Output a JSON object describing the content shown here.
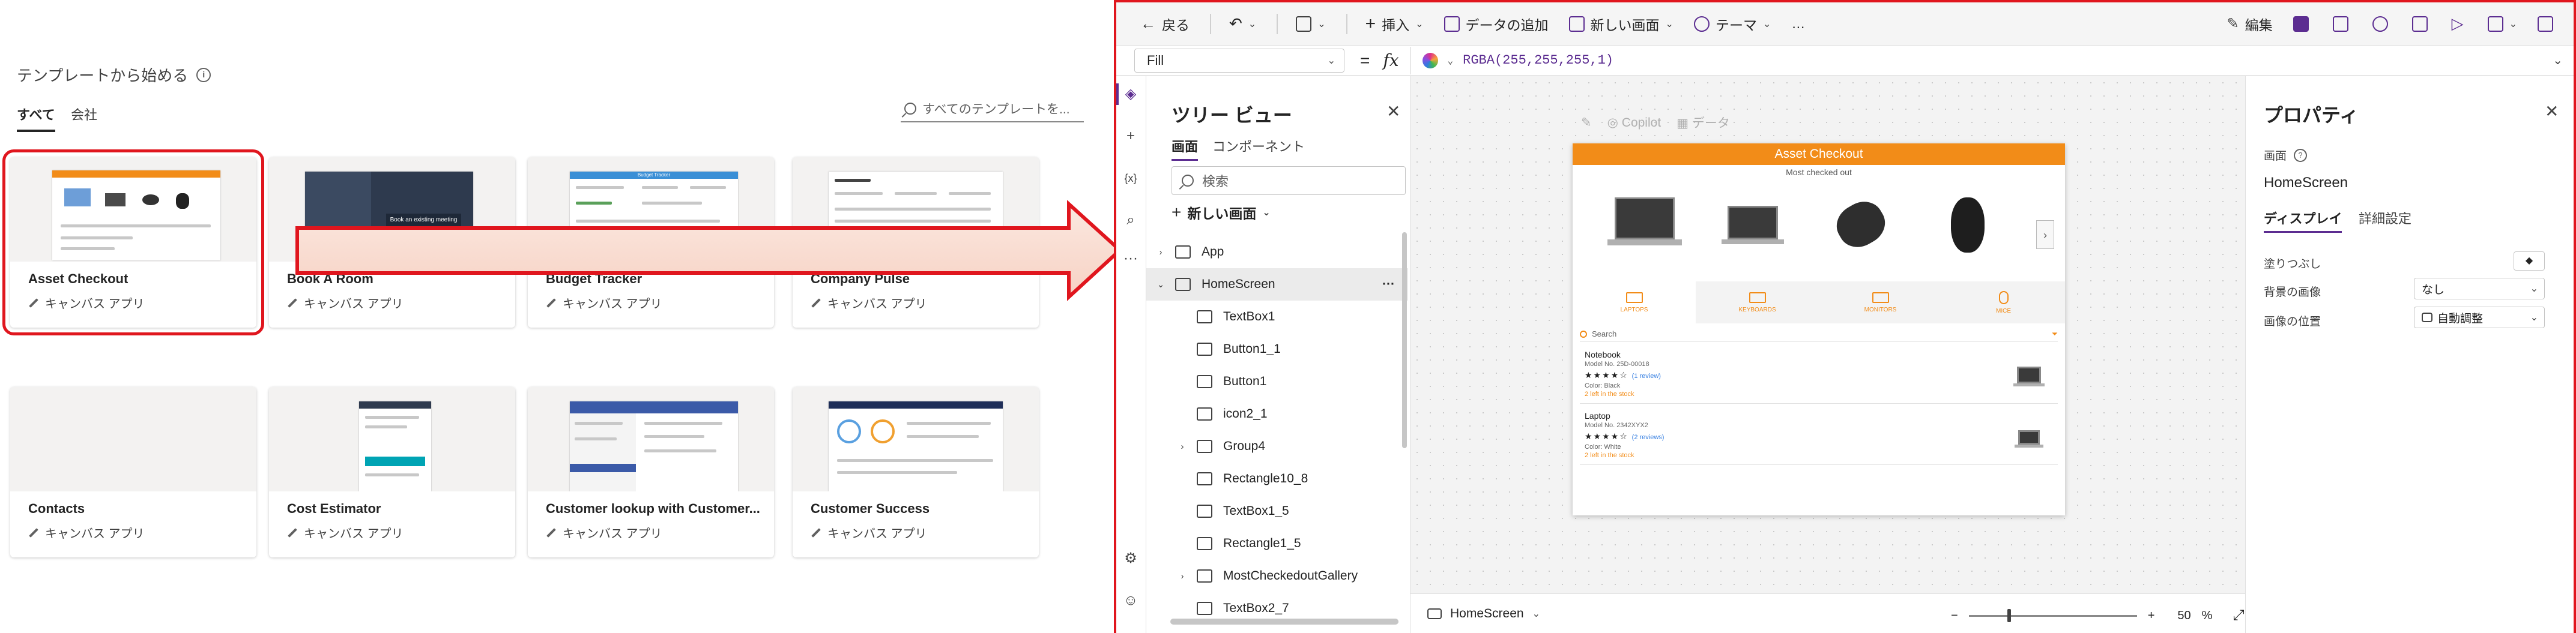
{
  "gallery": {
    "title": "テンプレートから始める",
    "tabs": [
      {
        "label": "すべて",
        "active": true
      },
      {
        "label": "会社",
        "active": false
      }
    ],
    "search_placeholder": "すべてのテンプレートを...",
    "cards": [
      {
        "name": "Asset Checkout",
        "type": "キャンバス アプリ",
        "selected": true
      },
      {
        "name": "Book A Room",
        "type": "キャンバス アプリ",
        "selected": false,
        "thumb_text": "Book an existing meeting"
      },
      {
        "name": "Budget Tracker",
        "type": "キャンバス アプリ",
        "selected": false,
        "thumb_text": "Budget Tracker"
      },
      {
        "name": "Company Pulse",
        "type": "キャンバス アプリ",
        "selected": false
      },
      {
        "name": "Contacts",
        "type": "キャンバス アプリ",
        "selected": false
      },
      {
        "name": "Cost Estimator",
        "type": "キャンバス アプリ",
        "selected": false
      },
      {
        "name": "Customer lookup with Customer...",
        "type": "キャンバス アプリ",
        "selected": false
      },
      {
        "name": "Customer Success",
        "type": "キャンバス アプリ",
        "selected": false
      }
    ]
  },
  "studio": {
    "commands": {
      "back": "戻る",
      "insert": "挿入",
      "add_data": "データの追加",
      "new_screen": "新しい画面",
      "theme": "テーマ",
      "more": "…",
      "edit": "編集"
    },
    "formula_bar": {
      "property": "Fill",
      "equals": "=",
      "fx": "fx",
      "formula": "RGBA(255,255,255,1)"
    },
    "tree_view": {
      "title": "ツリー ビュー",
      "tabs": [
        {
          "label": "画面",
          "active": true
        },
        {
          "label": "コンポーネント",
          "active": false
        }
      ],
      "search_placeholder": "検索",
      "new_screen": "新しい画面",
      "nodes": [
        {
          "label": "App",
          "level": 0,
          "expander": "›",
          "selected": false
        },
        {
          "label": "HomeScreen",
          "level": 0,
          "expander": "⌄",
          "selected": true,
          "more": "···"
        },
        {
          "label": "TextBox1",
          "level": 1,
          "expander": "",
          "selected": false
        },
        {
          "label": "Button1_1",
          "level": 1,
          "expander": "",
          "selected": false
        },
        {
          "label": "Button1",
          "level": 1,
          "expander": "",
          "selected": false
        },
        {
          "label": "icon2_1",
          "level": 1,
          "expander": "",
          "selected": false
        },
        {
          "label": "Group4",
          "level": 1,
          "expander": "›",
          "selected": false
        },
        {
          "label": "Rectangle10_8",
          "level": 1,
          "expander": "",
          "selected": false
        },
        {
          "label": "TextBox1_5",
          "level": 1,
          "expander": "",
          "selected": false
        },
        {
          "label": "Rectangle1_5",
          "level": 1,
          "expander": "",
          "selected": false
        },
        {
          "label": "MostCheckedoutGallery",
          "level": 1,
          "expander": "›",
          "selected": false
        },
        {
          "label": "TextBox2_7",
          "level": 1,
          "expander": "",
          "selected": false
        }
      ]
    },
    "canvas": {
      "floatbar": {
        "copilot": "Copilot",
        "data": "データ"
      },
      "app": {
        "header": "Asset Checkout",
        "subtitle": "Most checked out",
        "next": "›",
        "categories": [
          {
            "label": "LAPTOPS",
            "active": true
          },
          {
            "label": "KEYBOARDS",
            "active": false
          },
          {
            "label": "MONITORS",
            "active": false
          },
          {
            "label": "MICE",
            "active": false
          }
        ],
        "search": "Search",
        "items": [
          {
            "name": "Notebook",
            "model": "Model No. 25D-00018",
            "stars": "★★★★☆",
            "reviews": "(1 review)",
            "color": "Color: Black",
            "stock": "2 left in the stock"
          },
          {
            "name": "Laptop",
            "model": "Model No. 2342XYX2",
            "stars": "★★★★☆",
            "reviews": "(2 reviews)",
            "color": "Color: White",
            "stock": "2 left in the stock"
          }
        ]
      }
    },
    "status": {
      "screen": "HomeScreen",
      "zoom_minus": "−",
      "zoom_plus": "+",
      "zoom_value": "50",
      "zoom_unit": "%",
      "zoom_level": 0.5
    },
    "properties": {
      "title": "プロパティ",
      "section": "画面",
      "screen_name": "HomeScreen",
      "tabs": [
        {
          "label": "ディスプレイ",
          "active": true
        },
        {
          "label": "詳細設定",
          "active": false
        }
      ],
      "fill_label": "塗りつぶし",
      "bg_image_label": "背景の画像",
      "bg_image_value": "なし",
      "image_pos_label": "画像の位置",
      "image_pos_value": "自動調整"
    }
  },
  "colors": {
    "highlight_red": "#e0161e",
    "power_apps_purple": "#5c2d91",
    "app_orange": "#f28c18"
  }
}
